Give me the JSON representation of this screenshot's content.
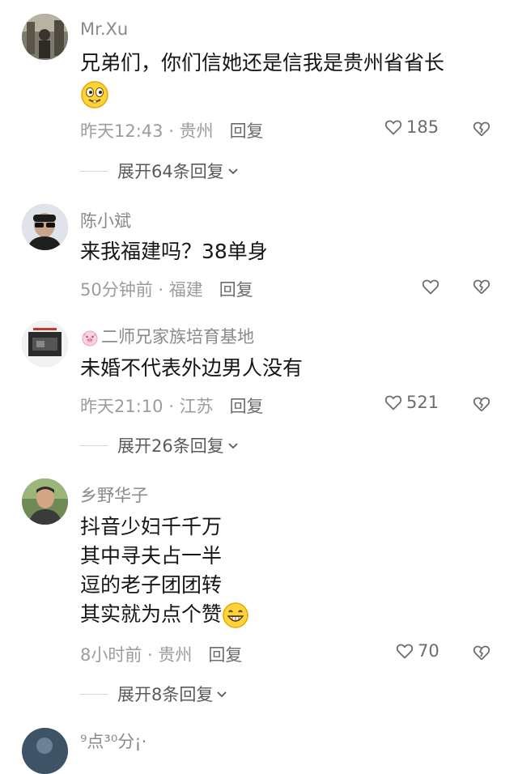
{
  "comments": [
    {
      "username": "Mr.Xu",
      "text": "兄弟们，你们信她还是信我是贵州省省长",
      "time": "昨天12:43",
      "location": "贵州",
      "reply_label": "回复",
      "likes": "185",
      "expand": "展开64条回复",
      "emoji": "smirk-emoji"
    },
    {
      "username": "陈小斌",
      "text": "来我福建吗？38单身",
      "time": "50分钟前",
      "location": "福建",
      "reply_label": "回复",
      "likes": ""
    },
    {
      "username": "二师兄家族培育基地",
      "text": "未婚不代表外边男人没有",
      "time": "昨天21:10",
      "location": "江苏",
      "reply_label": "回复",
      "likes": "521",
      "expand": "展开26条回复",
      "badge": "pig-icon"
    },
    {
      "username": "乡野华子",
      "lines": [
        "抖音少妇千千万",
        "其中寻夫占一半",
        "逗的老子团团转",
        "其实就为点个赞"
      ],
      "time": "8小时前",
      "location": "贵州",
      "reply_label": "回复",
      "likes": "70",
      "expand": "展开8条回复",
      "emoji": "grin-emoji"
    },
    {
      "username": "⁹点³⁰分¡·"
    }
  ],
  "separator": " · "
}
